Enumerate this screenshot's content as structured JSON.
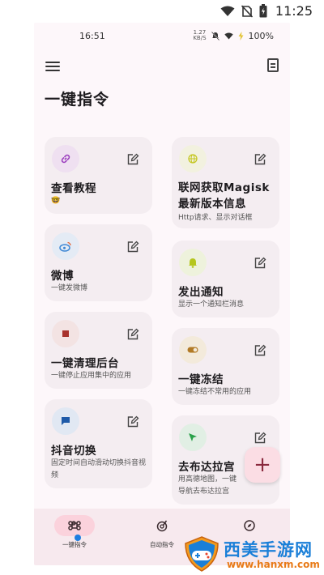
{
  "system_status": {
    "time": "11:25"
  },
  "app_status": {
    "time": "16:51",
    "speed_top": "1.27",
    "speed_unit": "KB/S",
    "battery": "100%"
  },
  "header": {
    "title": "一键指令",
    "menu_icon": "hamburger-menu-icon",
    "doc_icon": "document-icon"
  },
  "cards": [
    {
      "id": "tutorial",
      "title": "查看教程",
      "desc": "🤓",
      "icon": "link-icon",
      "icon_color": "#9c3fbf",
      "icon_bg": "#efe0f1"
    },
    {
      "id": "magisk",
      "title": "联网获取Magisk最新版本信息",
      "desc": "Http请求、显示对话框",
      "icon": "globe-icon",
      "icon_color": "#c3c51b",
      "icon_bg": "#f2f1df"
    },
    {
      "id": "weibo",
      "title": "微博",
      "desc": "一键发微博",
      "icon": "weibo-icon",
      "icon_color": "#3d86d4",
      "icon_bg": "#e4ebf5"
    },
    {
      "id": "notify",
      "title": "发出通知",
      "desc": "显示一个通知栏消息",
      "icon": "bell-icon",
      "icon_color": "#b5c61d",
      "icon_bg": "#eef2dc"
    },
    {
      "id": "clean",
      "title": "一键清理后台",
      "desc": "一键停止应用集中的应用",
      "icon": "stop-square-icon",
      "icon_color": "#a8322d",
      "icon_bg": "#f3e3e3"
    },
    {
      "id": "freeze",
      "title": "一键冻结",
      "desc": "一键冻结不常用的应用",
      "icon": "toggle-icon",
      "icon_color": "#b27a26",
      "icon_bg": "#f3eadb"
    },
    {
      "id": "douyin",
      "title": "抖音切换",
      "desc": "固定时间自动滑动切换抖音视频",
      "icon": "chat-bubble-icon",
      "icon_color": "#1f5aa8",
      "icon_bg": "#e1e8f3"
    },
    {
      "id": "navigate",
      "title": "去布达拉宫",
      "desc": "用高德地图，一键导航去布达拉宫",
      "icon": "navigation-arrow-icon",
      "icon_color": "#2aa14a",
      "icon_bg": "#e1efe4"
    }
  ],
  "fab": {
    "label": "+"
  },
  "bottom_nav": [
    {
      "label": "一键指令",
      "icon": "command-icon",
      "active": true
    },
    {
      "label": "自动指令",
      "icon": "timer-target-icon",
      "active": false
    },
    {
      "label": "",
      "icon": "compass-icon",
      "active": false
    }
  ],
  "watermark": {
    "name": "西美手游网",
    "url": "www.hanxm.com"
  }
}
